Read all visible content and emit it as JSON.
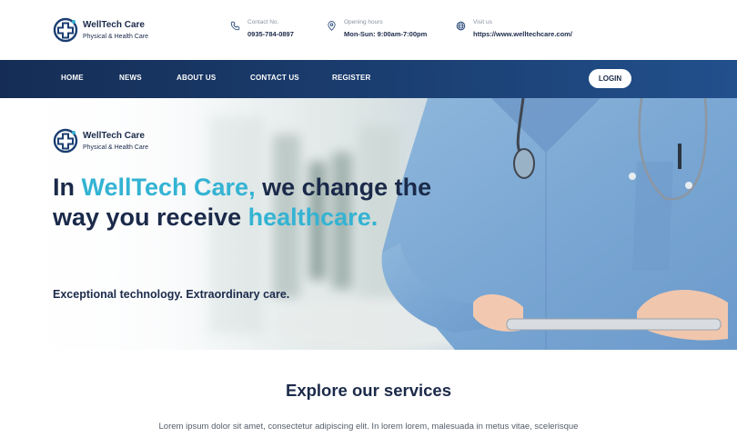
{
  "brand": {
    "name": "WellTech Care",
    "tagline": "Physical & Health Care",
    "logo_icon": "medical-cross-icon",
    "color": "#1b2a4a"
  },
  "contact_info": {
    "phone": {
      "icon": "phone-icon",
      "label": "Contact No.",
      "value": "0935-784-0897"
    },
    "hours": {
      "icon": "location-pin-icon",
      "label": "Opening hours",
      "value": "Mon-Sun: 9:00am-7:00pm"
    },
    "visit": {
      "icon": "globe-icon",
      "label": "Visit us",
      "value": "https://www.welltechcare.com/"
    }
  },
  "nav": {
    "items": [
      {
        "label": "HOME"
      },
      {
        "label": "NEWS"
      },
      {
        "label": "ABOUT US"
      },
      {
        "label": "CONTACT US"
      },
      {
        "label": "REGISTER"
      }
    ],
    "login_label": "LOGIN",
    "background": "#1b3f72"
  },
  "hero": {
    "brand_name": "WellTech Care",
    "brand_tagline": "Physical & Health Care",
    "headline_part1": "In ",
    "headline_accent1": "WellTech Care,",
    "headline_part2": " we change the way you receive ",
    "headline_accent2": "healthcare.",
    "subheadline": "Exceptional technology. Extraordinary care.",
    "accent_color": "#34b3d3"
  },
  "services": {
    "title": "Explore our services",
    "description": "Lorem ipsum dolor sit amet, consectetur adipiscing elit. In lorem lorem, malesuada in metus vitae, scelerisque"
  }
}
